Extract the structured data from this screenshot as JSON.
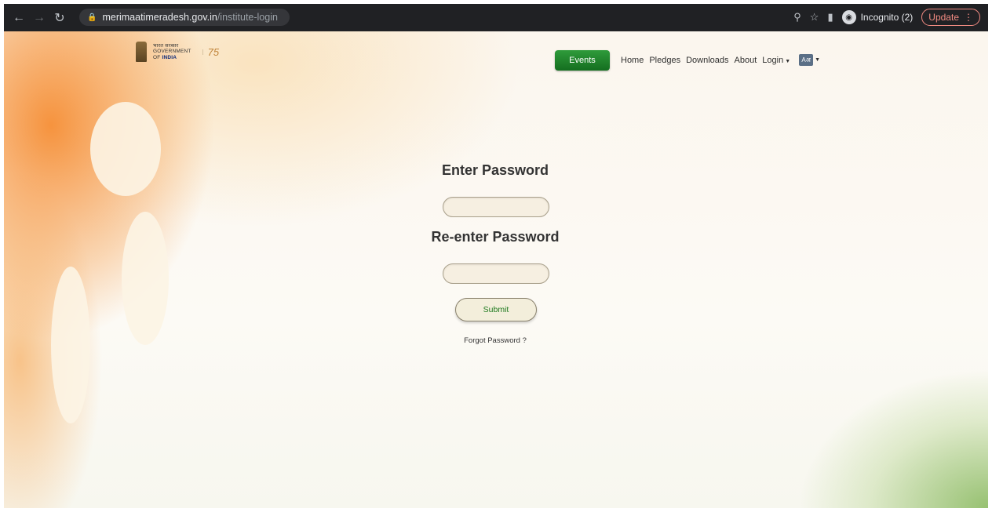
{
  "browser": {
    "url_host": "merimaatimeradesh.gov.in",
    "url_path": "/institute-login",
    "incognito_label": "Incognito (2)",
    "update_label": "Update",
    "icons": [
      "back-icon",
      "forward-icon",
      "reload-icon",
      "lock-icon",
      "zoom-icon",
      "star-icon",
      "sidepanel-icon",
      "incognito-icon",
      "menu-icon"
    ]
  },
  "header": {
    "logo_hindi": "भारत सरकार",
    "logo_gov": "GOVERNMENT",
    "logo_of": "OF",
    "logo_india": "INDIA",
    "events_label": "Events",
    "nav": {
      "home": "Home",
      "pledges": "Pledges",
      "downloads": "Downloads",
      "about": "About",
      "login": "Login"
    }
  },
  "form": {
    "password_label": "Enter Password",
    "reenter_label": "Re-enter Password",
    "password_value": "",
    "reenter_value": "",
    "submit_label": "Submit",
    "forgot_label": "Forgot Password ?"
  },
  "colors": {
    "events_green": "#1e8a2a",
    "saffron": "#f58220",
    "green": "#6eaa3c",
    "submit_text": "#1f7a1f"
  }
}
